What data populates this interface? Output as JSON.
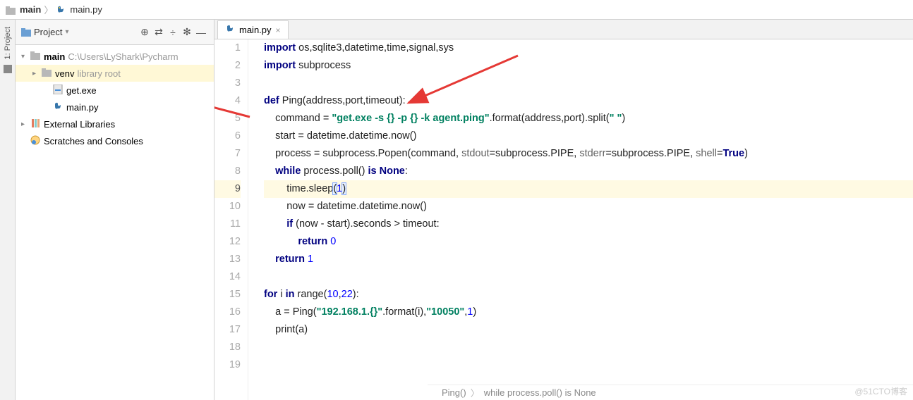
{
  "breadcrumb": {
    "folder": "main",
    "file": "main.py"
  },
  "sidebar": {
    "title": "Project",
    "tree": {
      "root": {
        "name": "main",
        "path": "C:\\Users\\LyShark\\Pycharm"
      },
      "venv": {
        "name": "venv",
        "hint": "library root"
      },
      "files": [
        "get.exe",
        "main.py"
      ],
      "external": "External Libraries",
      "scratches": "Scratches and Consoles"
    }
  },
  "left_rail": {
    "label": "1: Project"
  },
  "tabs": [
    {
      "label": "main.py"
    }
  ],
  "code": {
    "lines": [
      {
        "n": 1,
        "tokens": [
          {
            "t": "import ",
            "c": "kw"
          },
          {
            "t": "os,sqlite3,datetime,time,signal,sys"
          }
        ]
      },
      {
        "n": 2,
        "tokens": [
          {
            "t": "import ",
            "c": "kw"
          },
          {
            "t": "subprocess"
          }
        ]
      },
      {
        "n": 3,
        "tokens": []
      },
      {
        "n": 4,
        "tokens": [
          {
            "t": "def ",
            "c": "kw"
          },
          {
            "t": "Ping(address,port,timeout):"
          }
        ]
      },
      {
        "n": 5,
        "indent": 1,
        "tokens": [
          {
            "t": "command = "
          },
          {
            "t": "\"get.exe -s {} -p {} -k agent.ping\"",
            "c": "str"
          },
          {
            "t": ".format(address,port).split("
          },
          {
            "t": "\" \"",
            "c": "str"
          },
          {
            "t": ")"
          }
        ]
      },
      {
        "n": 6,
        "indent": 1,
        "tokens": [
          {
            "t": "start = datetime.datetime.now()"
          }
        ]
      },
      {
        "n": 7,
        "indent": 1,
        "tokens": [
          {
            "t": "process = subprocess.Popen(command, "
          },
          {
            "t": "stdout",
            "c": "param"
          },
          {
            "t": "=subprocess.PIPE, "
          },
          {
            "t": "stderr",
            "c": "param"
          },
          {
            "t": "=subprocess.PIPE, "
          },
          {
            "t": "shell",
            "c": "param"
          },
          {
            "t": "="
          },
          {
            "t": "True",
            "c": "bool"
          },
          {
            "t": ")"
          }
        ]
      },
      {
        "n": 8,
        "indent": 1,
        "tokens": [
          {
            "t": "while ",
            "c": "kw"
          },
          {
            "t": "process.poll() "
          },
          {
            "t": "is ",
            "c": "kw"
          },
          {
            "t": "None",
            "c": "none"
          },
          {
            "t": ":"
          }
        ]
      },
      {
        "n": 9,
        "indent": 2,
        "current": true,
        "tokens": [
          {
            "t": "time.sleep"
          },
          {
            "t": "(",
            "c": "highlight-box"
          },
          {
            "t": "1",
            "c": "num"
          },
          {
            "t": ")",
            "c": "highlight-box"
          }
        ]
      },
      {
        "n": 10,
        "indent": 2,
        "tokens": [
          {
            "t": "now = datetime.datetime.now()"
          }
        ]
      },
      {
        "n": 11,
        "indent": 2,
        "tokens": [
          {
            "t": "if ",
            "c": "kw"
          },
          {
            "t": "(now - start).seconds > timeout:"
          }
        ]
      },
      {
        "n": 12,
        "indent": 3,
        "tokens": [
          {
            "t": "return ",
            "c": "kw"
          },
          {
            "t": "0",
            "c": "num"
          }
        ]
      },
      {
        "n": 13,
        "indent": 1,
        "tokens": [
          {
            "t": "return ",
            "c": "kw"
          },
          {
            "t": "1",
            "c": "num"
          }
        ]
      },
      {
        "n": 14,
        "tokens": []
      },
      {
        "n": 15,
        "tokens": [
          {
            "t": "for ",
            "c": "kw"
          },
          {
            "t": "i "
          },
          {
            "t": "in ",
            "c": "kw"
          },
          {
            "t": "range("
          },
          {
            "t": "10",
            "c": "num"
          },
          {
            "t": ","
          },
          {
            "t": "22",
            "c": "num"
          },
          {
            "t": "):"
          }
        ]
      },
      {
        "n": 16,
        "indent": 1,
        "tokens": [
          {
            "t": "a = Ping("
          },
          {
            "t": "\"192.168.1.{}\"",
            "c": "str"
          },
          {
            "t": ".format(i),"
          },
          {
            "t": "\"10050\"",
            "c": "str"
          },
          {
            "t": ","
          },
          {
            "t": "1",
            "c": "num"
          },
          {
            "t": ")"
          }
        ]
      },
      {
        "n": 17,
        "indent": 1,
        "tokens": [
          {
            "t": "print(a)"
          }
        ]
      },
      {
        "n": 18,
        "tokens": []
      },
      {
        "n": 19,
        "tokens": []
      }
    ]
  },
  "status": {
    "fn": "Ping()",
    "ctx": "while process.poll() is None"
  },
  "watermark": "@51CTO博客"
}
